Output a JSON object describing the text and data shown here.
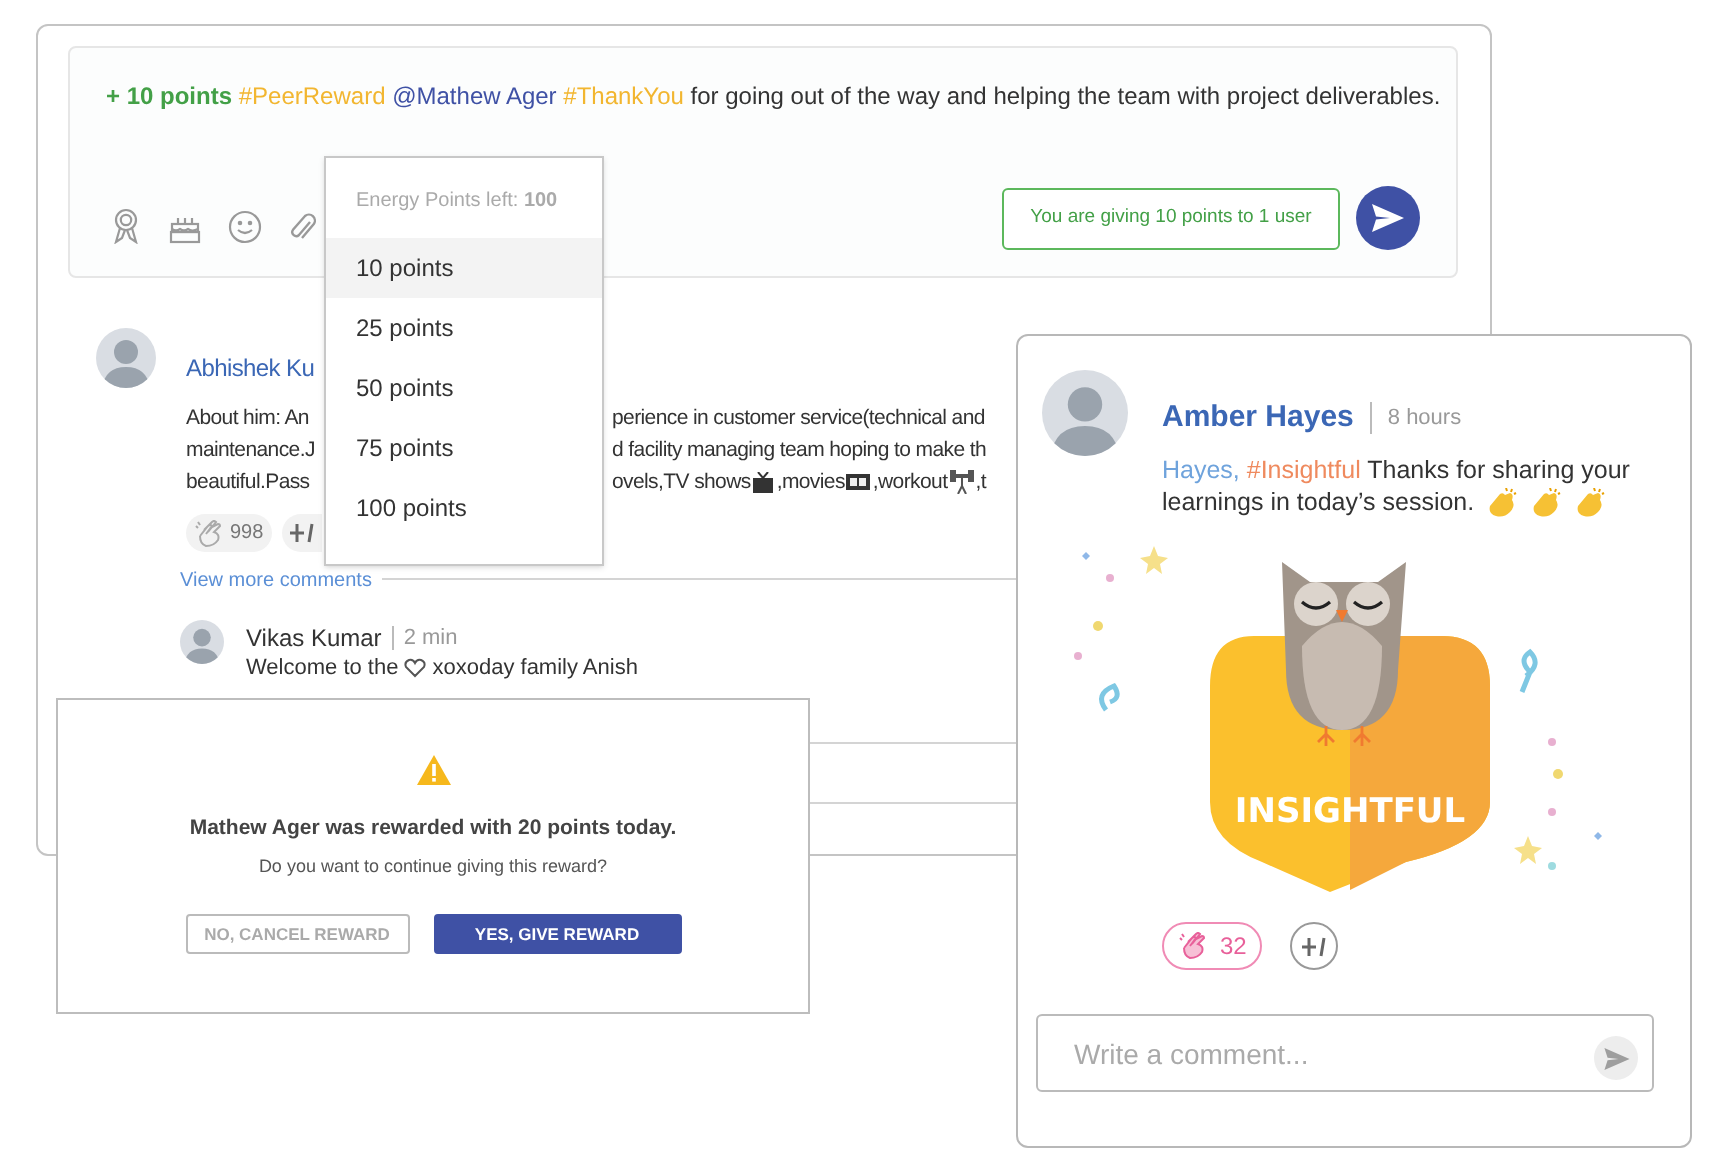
{
  "composer": {
    "message": [
      {
        "kind": "points",
        "text": "+ 10 points"
      },
      {
        "kind": "hashtag",
        "text": "#PeerReward"
      },
      {
        "kind": "mention",
        "text": "@Mathew Ager"
      },
      {
        "kind": "hashtag",
        "text": "#ThankYou"
      },
      {
        "kind": "plain",
        "text": "for going out of the way and helping the team with project deliverables."
      }
    ],
    "summary": "You are giving 10 points to 1 user"
  },
  "points_menu": {
    "header": "Energy Points left: **100**",
    "options": [
      {
        "label": "10 points",
        "selected": true
      },
      {
        "label": "25 points",
        "selected": false
      },
      {
        "label": "50 points",
        "selected": false
      },
      {
        "label": "75 points",
        "selected": false
      },
      {
        "label": "100 points",
        "selected": false
      }
    ]
  },
  "post": {
    "author": "Abhishek Ku",
    "about_lines": [
      {
        "left": "About him: An",
        "right": [
          {
            "kind": "text",
            "text": "perience in customer service(technical and"
          }
        ]
      },
      {
        "left": "maintenance.J",
        "right": [
          {
            "kind": "text",
            "text": "d facility managing team hoping to make th"
          }
        ]
      },
      {
        "left": "beautiful.Pass",
        "right": [
          {
            "kind": "text",
            "text": "ovels,TV shows"
          },
          {
            "kind": "tv"
          },
          {
            "kind": "text",
            "text": ",movies"
          },
          {
            "kind": "film"
          },
          {
            "kind": "text",
            "text": ",workout"
          },
          {
            "kind": "dumbbell"
          },
          {
            "kind": "text",
            "text": ",t"
          }
        ]
      }
    ],
    "reactions": [
      {
        "kind": "clap",
        "count": "998",
        "selected": false
      },
      {
        "kind": "plus_one"
      }
    ],
    "view_more": "View more comments",
    "comment": {
      "author": "Vikas Kumar",
      "time": "2 min",
      "text": [
        {
          "kind": "text",
          "text": "Welcome to the"
        },
        {
          "kind": "heart"
        },
        {
          "kind": "text",
          "text": "xoxoday family Anish"
        }
      ]
    }
  },
  "dialog": {
    "title": "Mathew Ager was rewarded with 20 points today.",
    "question": "Do you want to continue giving this reward?",
    "buttons": [
      {
        "kind": "secondary",
        "label": "NO, CANCEL REWARD"
      },
      {
        "kind": "primary",
        "label": "YES, GIVE REWARD"
      }
    ]
  },
  "feed_card": {
    "author": "Amber Hayes",
    "time": "8 hours",
    "message_lines": [
      [
        {
          "kind": "mention",
          "text": "Hayes,"
        },
        {
          "kind": "hashtag",
          "text": "#Insightful"
        },
        {
          "kind": "plain",
          "text": "Thanks for sharing your"
        }
      ],
      [
        {
          "kind": "plain",
          "text": "learnings in today’s session."
        }
      ]
    ],
    "badge": "INSIGHTFUL",
    "reactions": [
      {
        "kind": "clap",
        "count": "32",
        "selected": true
      },
      {
        "kind": "plus_one",
        "selected": false
      }
    ],
    "comment_placeholder": "Write a comment..."
  }
}
